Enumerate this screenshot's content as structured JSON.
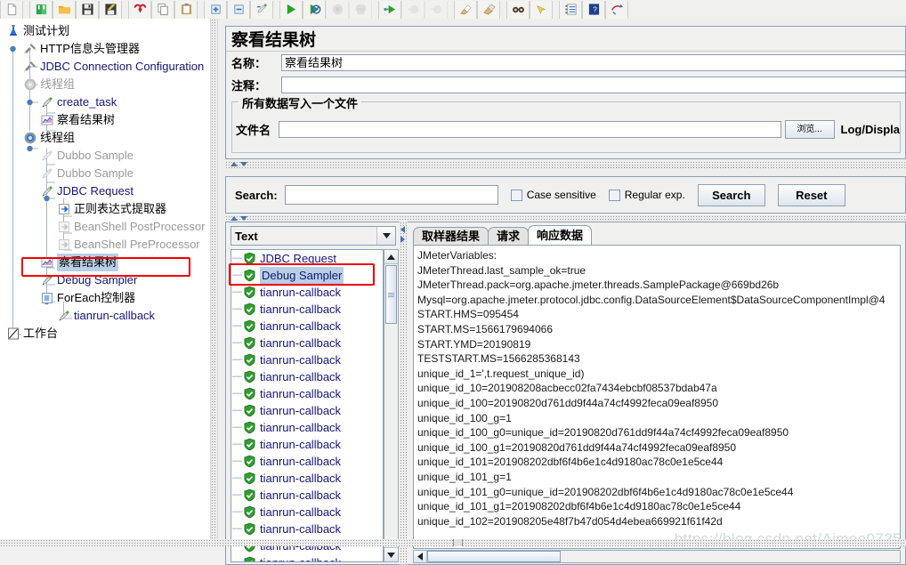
{
  "toolbar": {
    "buttons": [
      {
        "name": "new-icon",
        "group": 0
      },
      {
        "name": "templates-icon",
        "group": 1
      },
      {
        "name": "open-icon",
        "group": 1
      },
      {
        "name": "save-icon",
        "group": 1
      },
      {
        "name": "save-as-icon",
        "group": 1
      },
      {
        "name": "close-icon",
        "group": 2
      },
      {
        "name": "copy-icon",
        "group": 2
      },
      {
        "name": "paste-icon",
        "group": 2
      },
      {
        "name": "expand-all-icon",
        "group": 3
      },
      {
        "name": "collapse-all-icon",
        "group": 3
      },
      {
        "name": "toggle-icon",
        "group": 3
      },
      {
        "name": "start-icon",
        "group": 4
      },
      {
        "name": "start-no-pauses-icon",
        "group": 4
      },
      {
        "name": "stop-icon",
        "group": 4
      },
      {
        "name": "shutdown-icon",
        "group": 4
      },
      {
        "name": "remote-start-icon",
        "group": 5
      },
      {
        "name": "remote-stop-icon",
        "group": 5
      },
      {
        "name": "remote-shutdown-icon",
        "group": 5
      },
      {
        "name": "clear-icon",
        "group": 6
      },
      {
        "name": "clear-all-icon",
        "group": 6
      },
      {
        "name": "search-icon",
        "group": 7
      },
      {
        "name": "search-reset-icon",
        "group": 7
      },
      {
        "name": "function-helper-icon",
        "group": 8
      },
      {
        "name": "help-icon",
        "group": 8
      },
      {
        "name": "undo-icon",
        "group": 8
      }
    ]
  },
  "tree": {
    "nodes": [
      {
        "label": "测试计划",
        "icon": "test-plan-icon",
        "depth": 0,
        "style": "cn",
        "name": "tree-node-test-plan"
      },
      {
        "label": "HTTP信息头管理器",
        "icon": "header-manager-icon",
        "depth": 1,
        "style": "cn",
        "name": "tree-node-http-header-manager"
      },
      {
        "label": "JDBC Connection Configuration",
        "icon": "config-element-icon",
        "depth": 1,
        "style": "",
        "name": "tree-node-jdbc-connection-configuration"
      },
      {
        "label": "线程组",
        "icon": "thread-group-disabled-icon",
        "depth": 1,
        "style": "grey",
        "name": "tree-node-thread-group-1"
      },
      {
        "label": "create_task",
        "icon": "sampler-icon",
        "depth": 2,
        "style": "",
        "name": "tree-node-create-task"
      },
      {
        "label": "察看结果树",
        "icon": "view-results-tree-icon",
        "depth": 2,
        "style": "cn",
        "name": "tree-node-view-results-tree-1"
      },
      {
        "label": "线程组",
        "icon": "thread-group-icon",
        "depth": 1,
        "style": "cn",
        "name": "tree-node-thread-group-2"
      },
      {
        "label": "Dubbo Sample",
        "icon": "sampler-disabled-icon",
        "depth": 2,
        "style": "grey",
        "name": "tree-node-dubbo-sample-1"
      },
      {
        "label": "Dubbo Sample",
        "icon": "sampler-disabled-icon",
        "depth": 2,
        "style": "grey",
        "name": "tree-node-dubbo-sample-2"
      },
      {
        "label": "JDBC Request",
        "icon": "sampler-icon",
        "depth": 2,
        "style": "",
        "name": "tree-node-jdbc-request"
      },
      {
        "label": "正则表达式提取器",
        "icon": "post-processor-icon",
        "depth": 3,
        "style": "cn",
        "name": "tree-node-regex-extractor"
      },
      {
        "label": "BeanShell PostProcessor",
        "icon": "post-processor-disabled-icon",
        "depth": 3,
        "style": "grey",
        "name": "tree-node-beanshell-postprocessor"
      },
      {
        "label": "BeanShell PreProcessor",
        "icon": "pre-processor-disabled-icon",
        "depth": 3,
        "style": "grey",
        "name": "tree-node-beanshell-preprocessor"
      },
      {
        "label": "察看结果树",
        "icon": "view-results-tree-icon",
        "depth": 2,
        "style": "cn sel",
        "name": "tree-node-view-results-tree-2"
      },
      {
        "label": "Debug Sampler",
        "icon": "sampler-icon",
        "depth": 2,
        "style": "",
        "name": "tree-node-debug-sampler"
      },
      {
        "label": "ForEach控制器",
        "icon": "foreach-controller-icon",
        "depth": 2,
        "style": "cn",
        "name": "tree-node-foreach-controller"
      },
      {
        "label": "tianrun-callback",
        "icon": "sampler-icon",
        "depth": 3,
        "style": "",
        "name": "tree-node-tianrun-callback"
      },
      {
        "label": "工作台",
        "icon": "workbench-icon",
        "depth": 0,
        "style": "cn",
        "name": "tree-node-workbench"
      }
    ]
  },
  "config": {
    "title": "察看结果树",
    "name_label": "名称：",
    "name_value": "察看结果树",
    "comment_label": "注释：",
    "comment_value": "",
    "group_legend": "所有数据写入一个文件",
    "filename_label": "文件名",
    "filename_value": "",
    "browse_label": "浏览...",
    "log_display_label": "Log/Displa"
  },
  "search": {
    "label": "Search:",
    "value": "",
    "case_sensitive_label": "Case sensitive",
    "regular_exp_label": "Regular exp.",
    "search_button": "Search",
    "reset_button": "Reset"
  },
  "results": {
    "renderer_selected": "Text",
    "samples": [
      {
        "label": "JDBC Request",
        "selected": false
      },
      {
        "label": "Debug Sampler",
        "selected": true
      },
      {
        "label": "tianrun-callback",
        "selected": false
      },
      {
        "label": "tianrun-callback",
        "selected": false
      },
      {
        "label": "tianrun-callback",
        "selected": false
      },
      {
        "label": "tianrun-callback",
        "selected": false
      },
      {
        "label": "tianrun-callback",
        "selected": false
      },
      {
        "label": "tianrun-callback",
        "selected": false
      },
      {
        "label": "tianrun-callback",
        "selected": false
      },
      {
        "label": "tianrun-callback",
        "selected": false
      },
      {
        "label": "tianrun-callback",
        "selected": false
      },
      {
        "label": "tianrun-callback",
        "selected": false
      },
      {
        "label": "tianrun-callback",
        "selected": false
      },
      {
        "label": "tianrun-callback",
        "selected": false
      },
      {
        "label": "tianrun-callback",
        "selected": false
      },
      {
        "label": "tianrun-callback",
        "selected": false
      },
      {
        "label": "tianrun-callback",
        "selected": false
      },
      {
        "label": "tianrun-callback",
        "selected": false
      },
      {
        "label": "tianrun-callback",
        "selected": false
      }
    ],
    "tabs": [
      {
        "label": "取样器结果",
        "active": false,
        "name": "tab-sampler-result"
      },
      {
        "label": "请求",
        "active": false,
        "name": "tab-request"
      },
      {
        "label": "响应数据",
        "active": true,
        "name": "tab-response-data"
      }
    ],
    "response_lines": [
      "JMeterVariables:",
      "JMeterThread.last_sample_ok=true",
      "JMeterThread.pack=org.apache.jmeter.threads.SamplePackage@669bd26b",
      "Mysql=org.apache.jmeter.protocol.jdbc.config.DataSourceElement$DataSourceComponentImpl@4",
      "START.HMS=095454",
      "START.MS=1566179694066",
      "START.YMD=20190819",
      "TESTSTART.MS=1566285368143",
      "unique_id_1=',t.request_unique_id)",
      "unique_id_10=201908208acbecc02fa7434ebcbf08537bdab47a",
      "unique_id_100=20190820d761dd9f44a74cf4992feca09eaf8950",
      "unique_id_100_g=1",
      "unique_id_100_g0=unique_id=20190820d761dd9f44a74cf4992feca09eaf8950",
      "unique_id_100_g1=20190820d761dd9f44a74cf4992feca09eaf8950",
      "unique_id_101=201908202dbf6f4b6e1c4d9180ac78c0e1e5ce44",
      "unique_id_101_g=1",
      "unique_id_101_g0=unique_id=201908202dbf6f4b6e1c4d9180ac78c0e1e5ce44",
      "unique_id_101_g1=201908202dbf6f4b6e1c4d9180ac78c0e1e5ce44",
      "unique_id_102=201908205e48f7b47d054d4ebea669921f61f42d"
    ]
  },
  "watermark": "https://blog.csdn.net/Aimee0725",
  "colors": {
    "accent": "#16167a",
    "selection": "#b8cfe5",
    "highlight_box": "#f00000",
    "panel_border": "#8ba0b6"
  }
}
